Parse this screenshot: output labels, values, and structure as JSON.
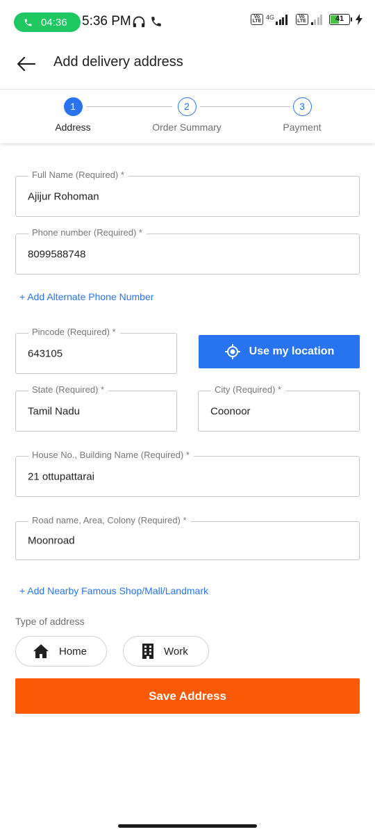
{
  "status_bar": {
    "call_timer": "04:36",
    "time": "5:36 PM",
    "network": "4G",
    "volte_label": "Vo LTE",
    "battery": "41"
  },
  "header": {
    "title": "Add delivery address"
  },
  "stepper": {
    "steps": [
      {
        "number": "1",
        "label": "Address"
      },
      {
        "number": "2",
        "label": "Order Summary"
      },
      {
        "number": "3",
        "label": "Payment"
      }
    ]
  },
  "form": {
    "full_name": {
      "label": "Full Name (Required) *",
      "value": "Ajijur Rohoman"
    },
    "phone": {
      "label": "Phone number (Required) *",
      "value": "8099588748"
    },
    "add_alt_phone": "+ Add Alternate Phone Number",
    "pincode": {
      "label": "Pincode (Required) *",
      "value": "643105"
    },
    "use_location": "Use my location",
    "state": {
      "label": "State (Required) *",
      "value": "Tamil Nadu"
    },
    "city": {
      "label": "City (Required) *",
      "value": "Coonoor"
    },
    "house": {
      "label": "House No., Building Name (Required) *",
      "value": "21 ottupattarai"
    },
    "road": {
      "label": "Road name, Area, Colony (Required) *",
      "value": "Moonroad"
    },
    "add_landmark": "+ Add Nearby Famous Shop/Mall/Landmark",
    "type_of_address": "Type of address",
    "home": "Home",
    "work": "Work",
    "save": "Save Address"
  },
  "colors": {
    "primary": "#2874f0",
    "save": "#fb5904",
    "call_pill": "#1ec760"
  }
}
